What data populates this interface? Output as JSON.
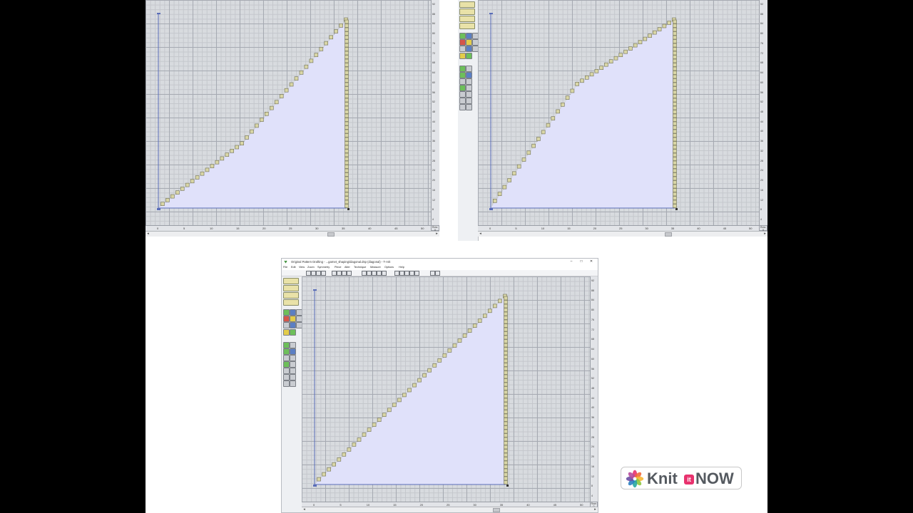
{
  "colors": {
    "fill": "#e0e1fa",
    "stitch": "#d9d6a6",
    "stitch_border": "#6f6f55",
    "baseline": "#5a6db8"
  },
  "panels": [
    {
      "name": "panel-top-left",
      "shape": "convex",
      "x_ticks": [
        "0",
        "5",
        "10",
        "15",
        "20",
        "25",
        "30",
        "35",
        "40",
        "45",
        "50"
      ],
      "y_ticks": [
        "92",
        "88",
        "84",
        "80",
        "76",
        "72",
        "68",
        "64",
        "60",
        "56",
        "52",
        "48",
        "44",
        "40",
        "36",
        "32",
        "28",
        "24",
        "20",
        "16",
        "12",
        "8",
        "4"
      ],
      "corner_label": "Row: 0",
      "staircase": {
        "steps": 38,
        "break_step": 17,
        "break_row": 13
      }
    },
    {
      "name": "panel-top-right",
      "shape": "concave",
      "x_ticks": [
        "0",
        "5",
        "10",
        "15",
        "20",
        "25",
        "30",
        "35",
        "40",
        "45",
        "50"
      ],
      "y_ticks": [
        "92",
        "88",
        "84",
        "80",
        "76",
        "72",
        "68",
        "64",
        "60",
        "56",
        "52",
        "48",
        "44",
        "40",
        "36",
        "32",
        "28",
        "24",
        "20",
        "16",
        "12",
        "8",
        "4"
      ],
      "corner_label": "Row: 0",
      "staircase": {
        "steps": 38,
        "break_step": 18,
        "break_row": 25
      }
    },
    {
      "name": "panel-bottom",
      "shape": "straight",
      "window_title": "Original Pattern Drafting - ...garnet_shaping\\diagonal.dsp (diagonal) - T-Arit",
      "menu": [
        "File",
        "Edit",
        "View",
        "Zoom",
        "Symmetry",
        "Piece",
        "Alter",
        "Technique",
        "Measure",
        "Options",
        "Help"
      ],
      "window_buttons": [
        "–",
        "□",
        "✕"
      ],
      "x_ticks": [
        "0",
        "5",
        "10",
        "15",
        "20",
        "25",
        "30",
        "35",
        "40",
        "45",
        "50"
      ],
      "y_ticks": [
        "92",
        "88",
        "84",
        "80",
        "76",
        "72",
        "68",
        "64",
        "60",
        "56",
        "52",
        "48",
        "44",
        "40",
        "36",
        "32",
        "28",
        "24",
        "20",
        "16",
        "12",
        "8",
        "4"
      ],
      "corner_label": "Row: 0",
      "staircase": {
        "steps": 38,
        "break_step": 19,
        "break_row": 19
      }
    }
  ],
  "logo": {
    "word1": "Knit",
    "badge": "it",
    "word2": "NOW"
  }
}
